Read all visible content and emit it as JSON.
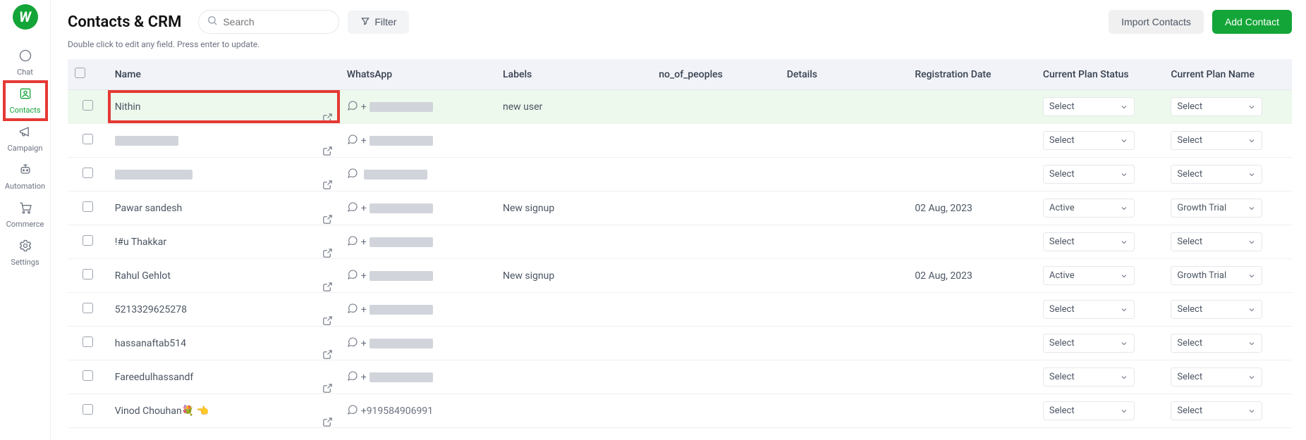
{
  "sidebar": {
    "items": [
      {
        "label": "Chat"
      },
      {
        "label": "Contacts"
      },
      {
        "label": "Campaign"
      },
      {
        "label": "Automation"
      },
      {
        "label": "Commerce"
      },
      {
        "label": "Settings"
      }
    ]
  },
  "header": {
    "title": "Contacts & CRM",
    "search_placeholder": "Search",
    "filter_label": "Filter",
    "import_label": "Import Contacts",
    "add_label": "Add Contact",
    "subtitle": "Double click to edit any field. Press enter to update."
  },
  "table": {
    "columns": {
      "name": "Name",
      "whatsapp": "WhatsApp",
      "labels": "Labels",
      "no_of_peoples": "no_of_peoples",
      "details": "Details",
      "registration_date": "Registration Date",
      "current_plan_status": "Current Plan Status",
      "current_plan_name": "Current Plan Name"
    },
    "rows": [
      {
        "name": "Nithin",
        "name_redacted": false,
        "whatsapp_prefix": "+",
        "wa_redacted": true,
        "labels": "new user",
        "reg_date": "",
        "plan_status": "Select",
        "plan_name": "Select",
        "highlighted": true
      },
      {
        "name": "",
        "name_redacted": true,
        "name_red_w": 90,
        "whatsapp_prefix": "+",
        "wa_redacted": true,
        "labels": "",
        "reg_date": "",
        "plan_status": "Select",
        "plan_name": "Select"
      },
      {
        "name": "",
        "name_redacted": true,
        "name_red_w": 110,
        "whatsapp_prefix": "",
        "wa_redacted": true,
        "labels": "",
        "reg_date": "",
        "plan_status": "Select",
        "plan_name": "Select"
      },
      {
        "name": "Pawar sandesh",
        "name_redacted": false,
        "whatsapp_prefix": "+",
        "wa_redacted": true,
        "labels": "New signup",
        "reg_date": "02 Aug, 2023",
        "plan_status": "Active",
        "plan_name": "Growth Trial"
      },
      {
        "name": "!#u Thakkar",
        "name_redacted": false,
        "whatsapp_prefix": "+",
        "wa_redacted": true,
        "labels": "",
        "reg_date": "",
        "plan_status": "Select",
        "plan_name": "Select"
      },
      {
        "name": "Rahul Gehlot",
        "name_redacted": false,
        "whatsapp_prefix": "+",
        "wa_redacted": true,
        "labels": "New signup",
        "reg_date": "02 Aug, 2023",
        "plan_status": "Active",
        "plan_name": "Growth Trial"
      },
      {
        "name": "5213329625278",
        "name_redacted": false,
        "whatsapp_prefix": "+",
        "wa_redacted": true,
        "labels": "",
        "reg_date": "",
        "plan_status": "Select",
        "plan_name": "Select"
      },
      {
        "name": "hassanaftab514",
        "name_redacted": false,
        "whatsapp_prefix": "+",
        "wa_redacted": true,
        "labels": "",
        "reg_date": "",
        "plan_status": "Select",
        "plan_name": "Select"
      },
      {
        "name": "Fareedulhassandf",
        "name_redacted": false,
        "whatsapp_prefix": "+",
        "wa_redacted": true,
        "labels": "",
        "reg_date": "",
        "plan_status": "Select",
        "plan_name": "Select"
      },
      {
        "name": "Vinod Chouhan💐 👈",
        "name_redacted": false,
        "whatsapp_prefix": "",
        "whatsapp": "+919584906991",
        "wa_redacted": false,
        "labels": "",
        "reg_date": "",
        "plan_status": "Select",
        "plan_name": "Select"
      }
    ]
  }
}
